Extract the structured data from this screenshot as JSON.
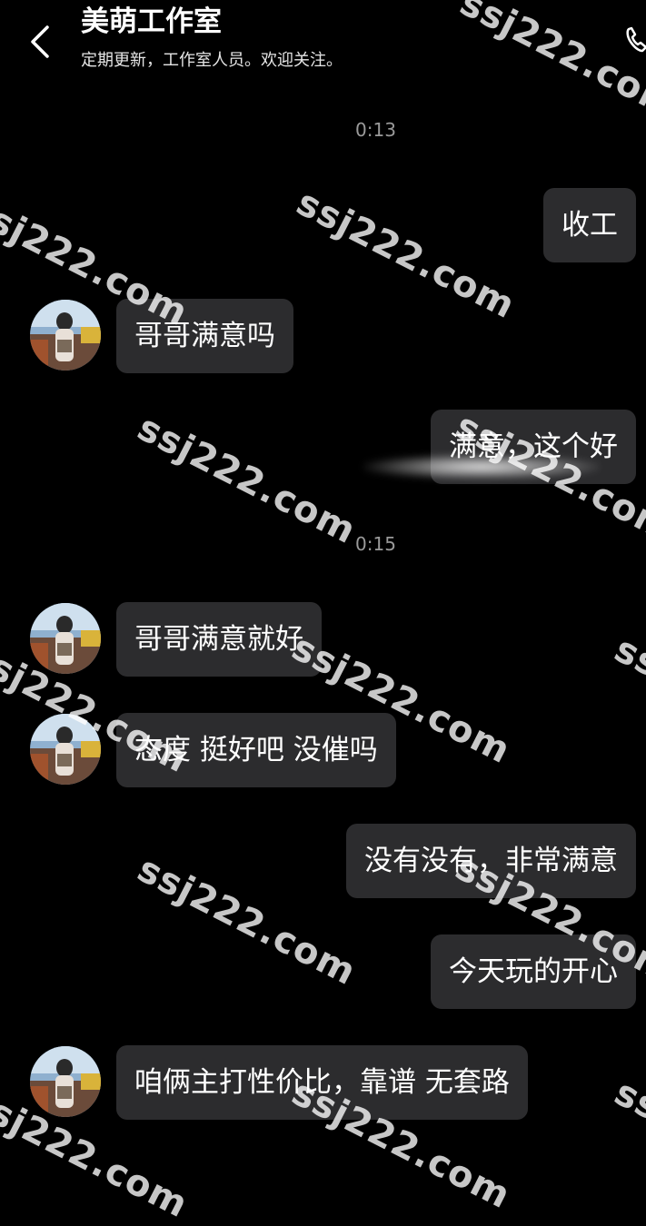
{
  "header": {
    "back_icon": "chevron-left-icon",
    "title": "美萌工作室",
    "subtitle": "定期更新，工作室人员。欢迎关注。",
    "call_icon": "phone-icon"
  },
  "timestamps": [
    "0:13",
    "0:15"
  ],
  "messages": [
    {
      "direction": "outgoing",
      "text": "收工"
    },
    {
      "direction": "incoming",
      "text": "哥哥满意吗"
    },
    {
      "direction": "outgoing",
      "text": "满意，这个好"
    },
    {
      "direction": "incoming",
      "text": "哥哥满意就好"
    },
    {
      "direction": "incoming",
      "text": "态度 挺好吧 没催吗"
    },
    {
      "direction": "outgoing",
      "text": "没有没有，非常满意"
    },
    {
      "direction": "outgoing",
      "text": "今天玩的开心"
    },
    {
      "direction": "incoming",
      "text": "咱俩主打性价比，靠谱 无套路"
    }
  ],
  "watermark": "ssj222.com",
  "colors": {
    "background": "#000000",
    "bubble": "#2c2c2e",
    "text": "#ffffff",
    "timestamp": "#9a9a9a"
  }
}
